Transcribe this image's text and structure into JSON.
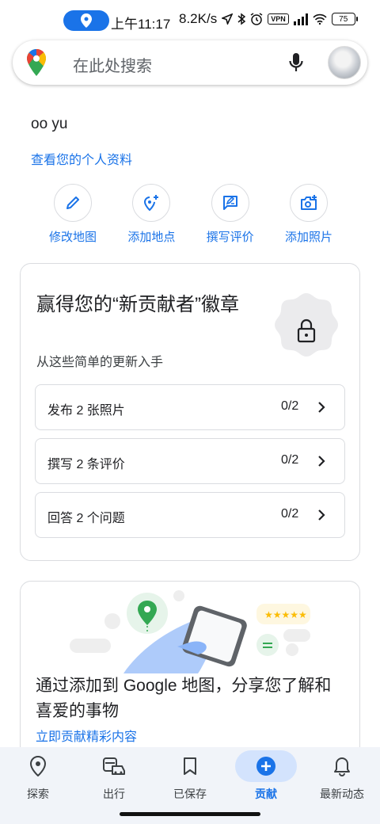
{
  "status_bar": {
    "time": "上午11:17",
    "speed": "8.2K/s",
    "vpn_label": "VPN",
    "battery": "75"
  },
  "search": {
    "placeholder": "在此处搜索",
    "logo_icon": "google-maps-pin-icon",
    "mic_icon": "mic-icon",
    "avatar": "profile-avatar"
  },
  "profile": {
    "name": "oo yu",
    "link": "查看您的个人资料"
  },
  "actions": [
    {
      "label": "修改地图",
      "icon": "pencil-icon"
    },
    {
      "label": "添加地点",
      "icon": "add-place-icon"
    },
    {
      "label": "撰写评价",
      "icon": "write-review-icon"
    },
    {
      "label": "添加照片",
      "icon": "add-photo-icon"
    }
  ],
  "badge_card": {
    "title": "赢得您的“新贡献者”徽章",
    "subtitle": "从这些简单的更新入手",
    "badge_icon": "lock-icon",
    "tasks": [
      {
        "label": "发布 2 张照片",
        "progress": "0/2"
      },
      {
        "label": "撰写 2 条评价",
        "progress": "0/2"
      },
      {
        "label": "回答 2 个问题",
        "progress": "0/2"
      }
    ]
  },
  "promo_card": {
    "title": "通过添加到 Google 地图，分享您了解和喜爱的事物",
    "link": "立即贡献精彩内容"
  },
  "bottom_nav": {
    "active": "贡献",
    "items": [
      {
        "label": "探索",
        "icon": "explore-pin-icon"
      },
      {
        "label": "出行",
        "icon": "commute-icon"
      },
      {
        "label": "已保存",
        "icon": "bookmark-icon"
      },
      {
        "label": "贡献",
        "icon": "add-circle-icon"
      },
      {
        "label": "最新动态",
        "icon": "bell-icon"
      }
    ]
  },
  "colors": {
    "accent": "#1a73e8",
    "nav_background": "#f1f4f9",
    "active_pill": "#d3e3fd",
    "border": "#dadce0"
  }
}
